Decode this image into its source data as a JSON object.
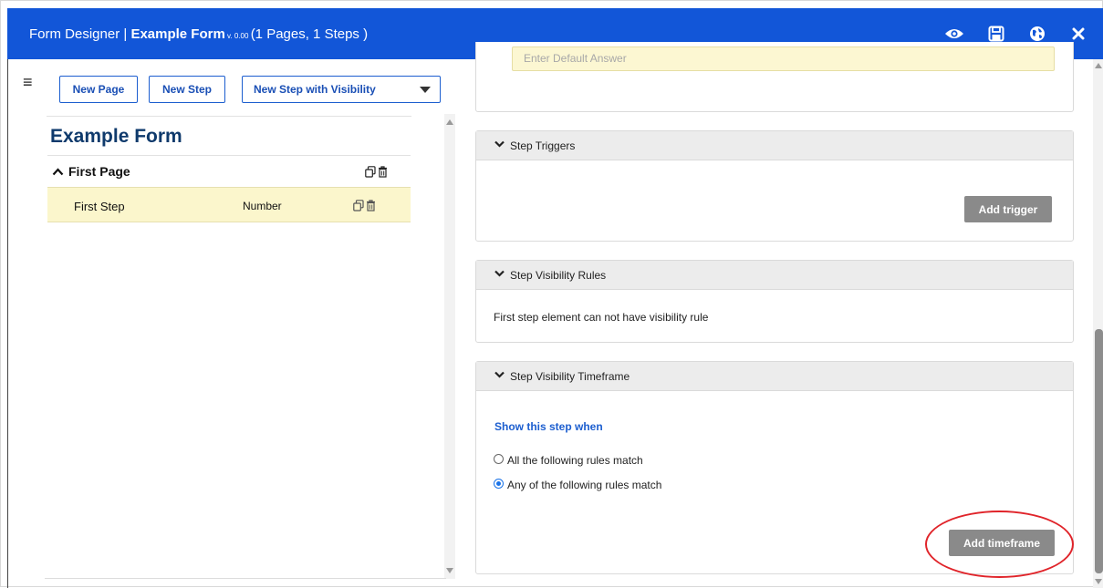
{
  "header": {
    "prefix": "Form Designer | ",
    "form_name": "Example Form",
    "version": " v. 0.00 ",
    "summary": "(1 Pages, 1 Steps )",
    "icons": [
      "eye-icon",
      "save-icon",
      "globe-icon",
      "close-icon"
    ],
    "bg_color": "#1256d8"
  },
  "toolbar": {
    "new_page_label": "New Page",
    "new_step_label": "New Step",
    "new_step_visibility_label": "New Step with Visibility"
  },
  "tree": {
    "form_title": "Example Form",
    "pages": [
      {
        "name": "First Page",
        "steps": [
          {
            "name": "First Step",
            "type": "Number"
          }
        ]
      }
    ]
  },
  "editor": {
    "default_answer_placeholder": "Enter Default Answer",
    "triggers": {
      "title": "Step Triggers",
      "add_label": "Add trigger"
    },
    "visibility_rules": {
      "title": "Step Visibility Rules",
      "message": "First step element can not have visibility rule"
    },
    "timeframe": {
      "title": "Step Visibility Timeframe",
      "show_when_label": "Show this step when",
      "options": [
        "All the following rules match",
        "Any of the following rules match"
      ],
      "selected_index": 1,
      "add_label": "Add timeframe"
    }
  },
  "colors": {
    "accent": "#1c5ecf",
    "selected_row": "#fbf6cc",
    "highlight": "#e0242a"
  }
}
